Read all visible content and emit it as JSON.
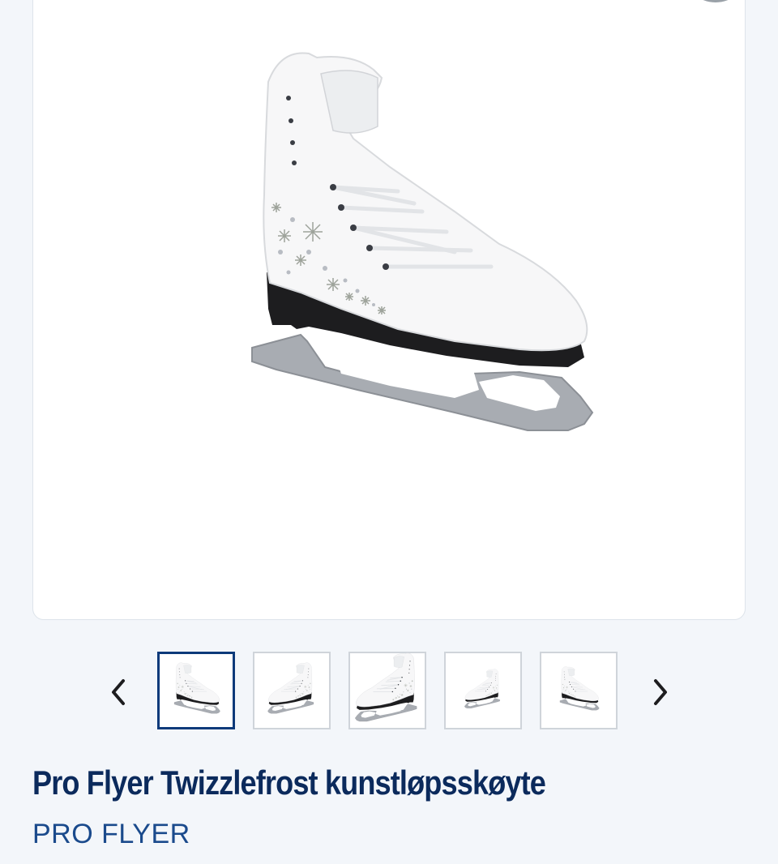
{
  "product": {
    "title": "Pro Flyer Twizzlefrost kunstløpsskøyte",
    "brand": "PRO FLYER"
  },
  "gallery": {
    "selected_index": 0,
    "thumbnails": [
      {
        "icon": "skate-thumbnail-icon"
      },
      {
        "icon": "skate-thumbnail-icon"
      },
      {
        "icon": "skate-closeup-thumbnail-icon"
      },
      {
        "icon": "skate-thumbnail-icon"
      },
      {
        "icon": "skate-thumbnail-icon"
      }
    ],
    "prev_icon": "chevron-left-icon",
    "next_icon": "chevron-right-icon"
  },
  "colors": {
    "title": "#0b2a5c",
    "brand": "#1a4a8c",
    "active_thumb_border": "#0d3a7a",
    "background": "#f3f6fa"
  }
}
